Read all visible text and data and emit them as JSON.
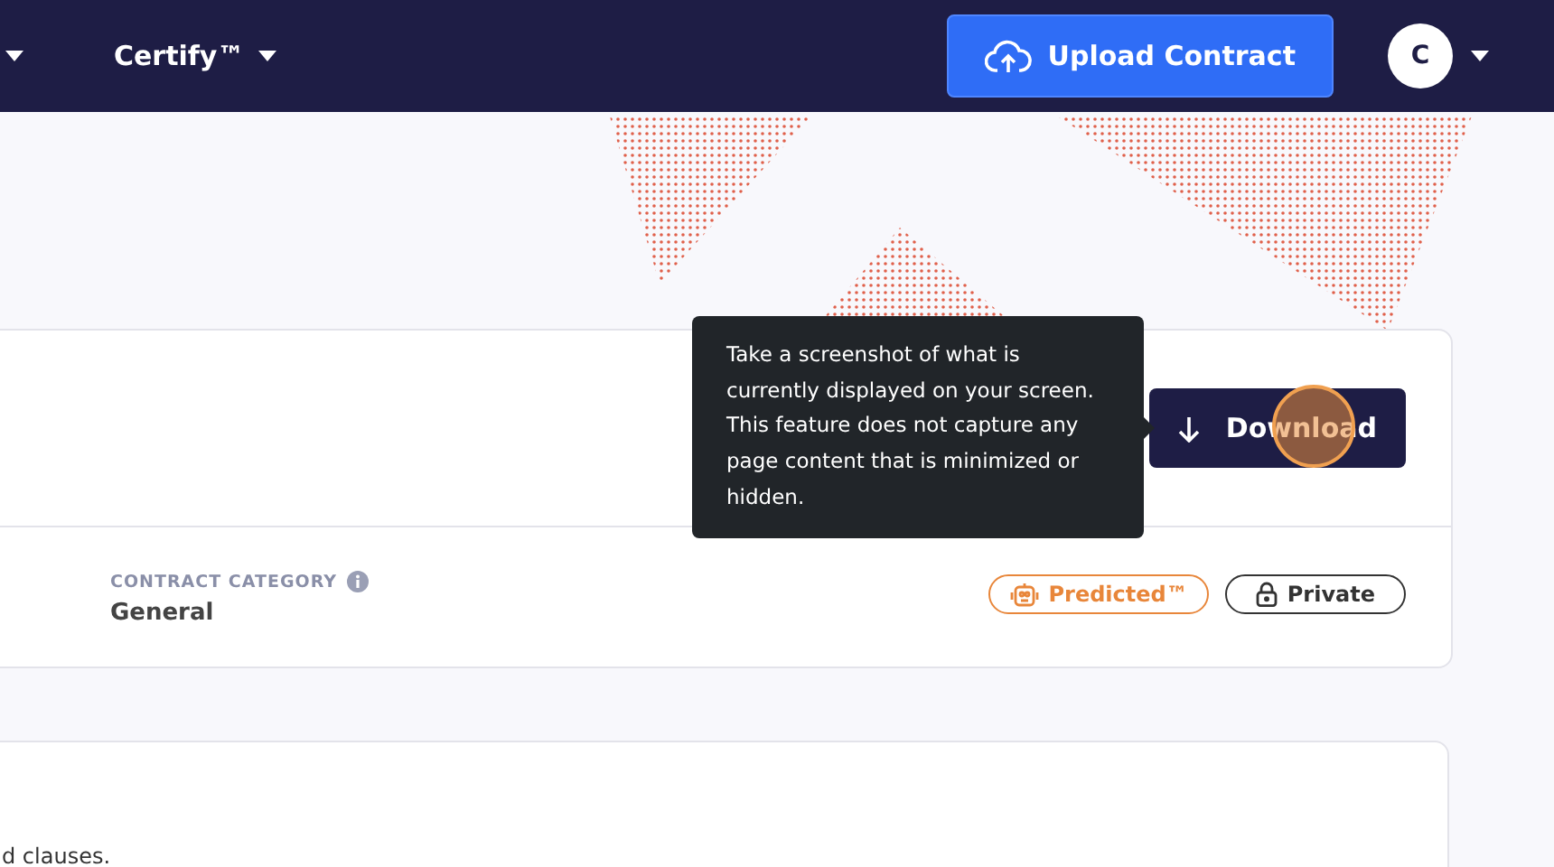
{
  "nav": {
    "menu_label": "Certify™",
    "upload_button": "Upload Contract",
    "avatar_initial": "C"
  },
  "contract_card": {
    "download_button": "Download",
    "tooltip": "Take a screenshot of what is currently displayed on your screen. This feature does not capture any page content that is minimized or hidden.",
    "category_label": "CONTRACT CATEGORY",
    "category_value": "General",
    "badges": [
      {
        "kind": "predicted",
        "label": "Predicted™"
      },
      {
        "kind": "private",
        "label": "Private"
      }
    ]
  },
  "second_card": {
    "text": "d clauses."
  }
}
